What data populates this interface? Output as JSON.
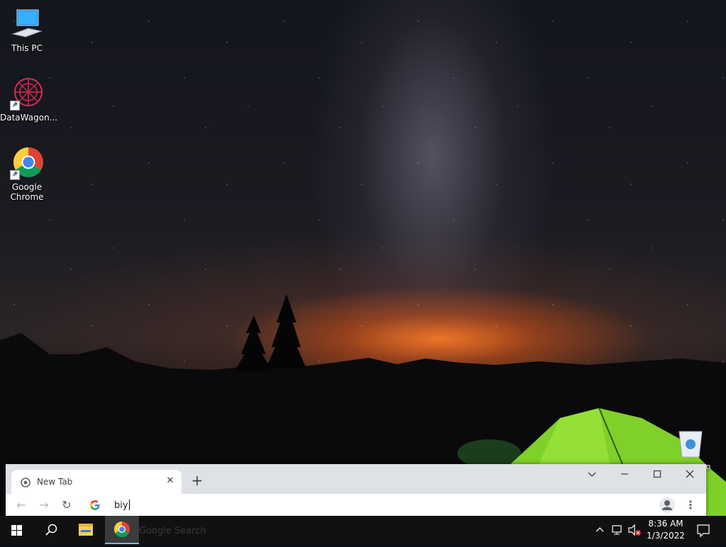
{
  "desktop": {
    "icons": [
      {
        "label": "This PC",
        "icon": "monitor-icon"
      },
      {
        "label": "DataWagon...",
        "icon": "datawagon-icon"
      },
      {
        "label": "Google Chrome",
        "icon": "chrome-icon"
      }
    ],
    "recycle_bin_label_fragment": "n"
  },
  "chrome": {
    "tab_title": "New Tab",
    "tab_close_symbol": "✕",
    "new_tab_symbol": "+",
    "window_controls": {
      "dropdown": "⌄",
      "minimize": "—",
      "maximize": "☐",
      "close": "✕"
    },
    "omnibox_text": "biy",
    "nav": {
      "back": "←",
      "forward": "→",
      "reload": "↻"
    },
    "menu_symbol": "⋮"
  },
  "taskbar": {
    "search_ghost_text": "Google Search",
    "clock": {
      "time": "8:36 AM",
      "date": "1/3/2022"
    },
    "tray_chevron": "^",
    "accent": "#76b9ed"
  }
}
